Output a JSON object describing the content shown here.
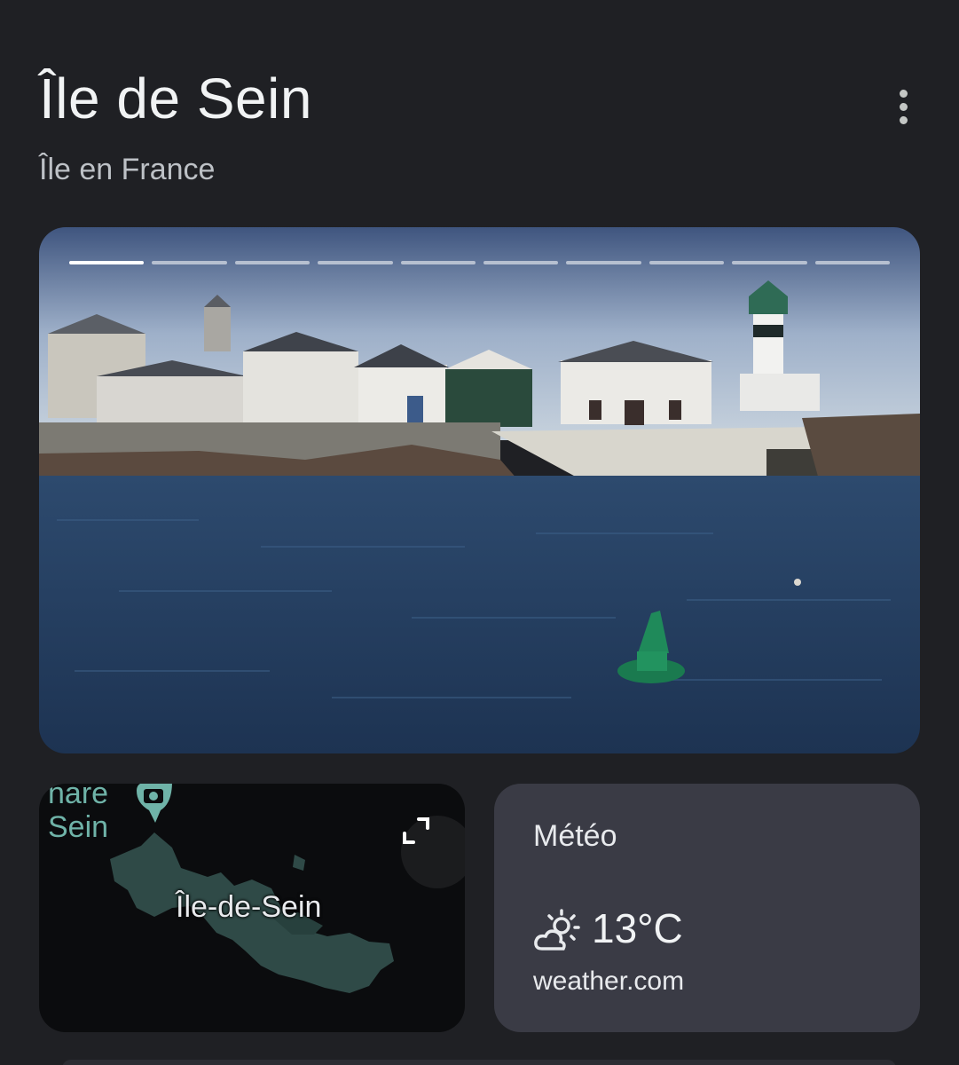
{
  "header": {
    "title": "Île de Sein",
    "subtitle": "Île en France",
    "more_icon": "more-vert-icon"
  },
  "carousel": {
    "segment_count": 10,
    "active_index": 0
  },
  "map": {
    "poi_label": "nare\nSein",
    "place_label": "Île-de-Sein",
    "poi_icon": "camera-pin-icon",
    "expand_icon": "expand-icon"
  },
  "weather": {
    "label": "Météo",
    "temperature": "13°C",
    "source": "weather.com",
    "icon": "partly-cloudy-icon"
  },
  "colors": {
    "background": "#1f2024",
    "weather_card": "#3a3b45",
    "map_land": "#2f4a47",
    "map_accent": "#6fb3a8"
  }
}
